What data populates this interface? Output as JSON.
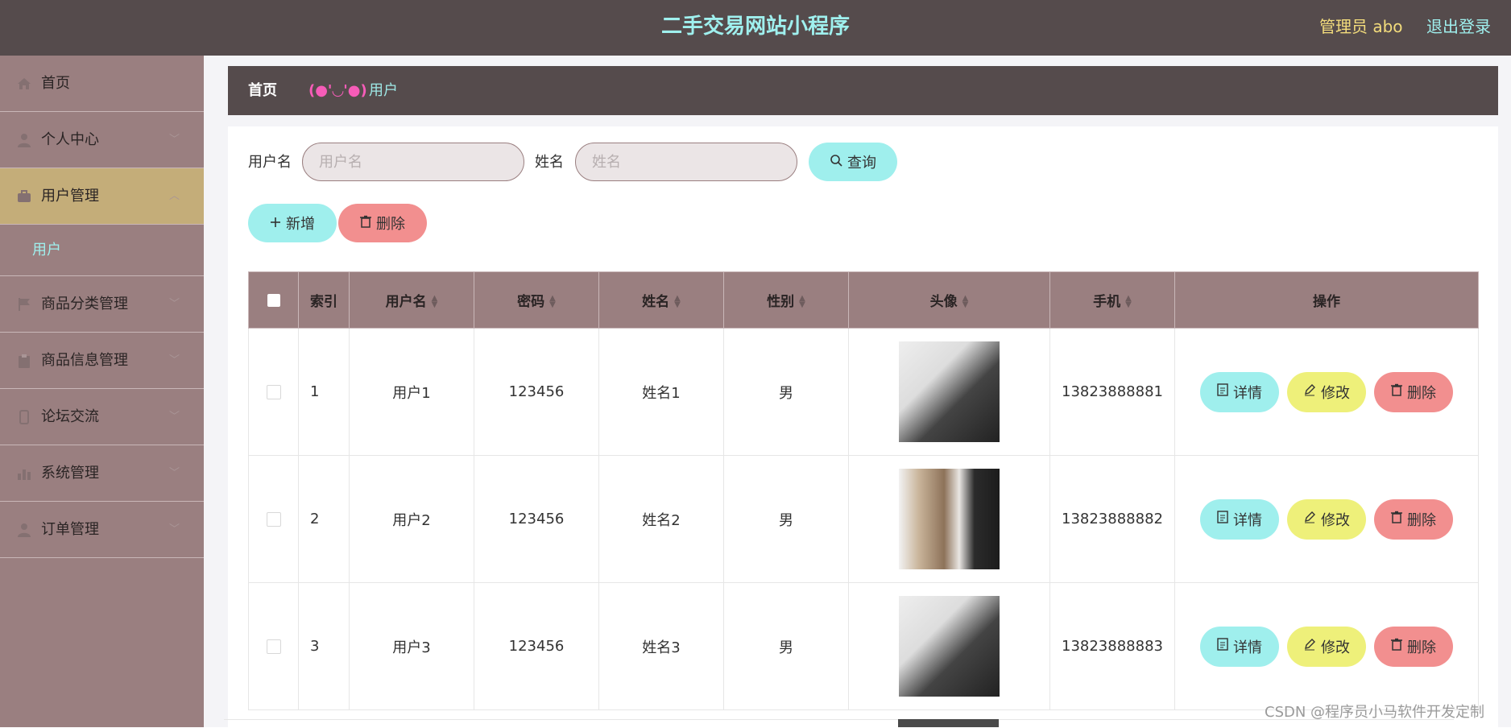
{
  "header": {
    "title": "二手交易网站小程序",
    "admin": "管理员 abo",
    "logout": "退出登录"
  },
  "sidebar": {
    "items": [
      {
        "label": "首页",
        "icon": "home-icon"
      },
      {
        "label": "个人中心",
        "icon": "user-icon"
      },
      {
        "label": "用户管理",
        "icon": "briefcase-icon",
        "active": true
      },
      {
        "label": "商品分类管理",
        "icon": "flag-icon"
      },
      {
        "label": "商品信息管理",
        "icon": "clipboard-icon"
      },
      {
        "label": "论坛交流",
        "icon": "phone-icon"
      },
      {
        "label": "系统管理",
        "icon": "bar-chart-icon"
      },
      {
        "label": "订单管理",
        "icon": "user-icon"
      }
    ],
    "submenu": {
      "label": "用户"
    }
  },
  "breadcrumb": {
    "home": "首页",
    "separator": "(●'◡'●)",
    "current": "用户"
  },
  "search": {
    "username_label": "用户名",
    "username_placeholder": "用户名",
    "name_label": "姓名",
    "name_placeholder": "姓名",
    "query_button": "查询"
  },
  "actions": {
    "add": "新增",
    "delete": "删除"
  },
  "table": {
    "headers": [
      "索引",
      "用户名",
      "密码",
      "姓名",
      "性别",
      "头像",
      "手机",
      "操作"
    ],
    "rows": [
      {
        "index": "1",
        "username": "用户1",
        "password": "123456",
        "name": "姓名1",
        "gender": "男",
        "phone": "13823888881"
      },
      {
        "index": "2",
        "username": "用户2",
        "password": "123456",
        "name": "姓名2",
        "gender": "男",
        "phone": "13823888882"
      },
      {
        "index": "3",
        "username": "用户3",
        "password": "123456",
        "name": "姓名3",
        "gender": "男",
        "phone": "13823888883"
      }
    ],
    "row_actions": {
      "detail": "详情",
      "edit": "修改",
      "delete": "删除"
    }
  },
  "watermark": "CSDN @程序员小马软件开发定制",
  "colors": {
    "header_bg": "#554b4c",
    "sidebar_bg": "#9a7f80",
    "active_menu": "#c4ad79",
    "accent_cyan": "#9fefed",
    "accent_pink": "#f28f8f",
    "accent_yellow": "#eef07a"
  }
}
